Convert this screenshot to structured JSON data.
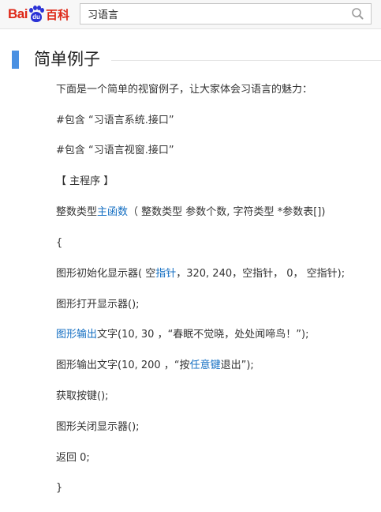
{
  "header": {
    "logo_left": "Bai",
    "logo_paw": "du",
    "logo_right": "百科",
    "search_value": "习语言"
  },
  "section": {
    "title": "简单例子"
  },
  "content": {
    "intro": "下面是一个简单的视窗例子，让大家体会习语言的魅力：",
    "include1": "#包含 “习语言系统.接口”",
    "include2": "#包含 “习语言视窗.接口”",
    "main_program": "【 主程序 】",
    "func_prefix": "整数类型",
    "func_link": "主函数",
    "func_suffix": "（ 整数类型 参数个数, 字符类型 *参数表[])",
    "open_brace": "{",
    "init_prefix": "图形初始化显示器( 空",
    "init_link": "指针",
    "init_suffix": "，320, 240，空指针，  0，  空指针);",
    "open_display": "图形打开显示器();",
    "out1_link": "图形输出",
    "out1_suffix": "文字(10, 30 ，“春眠不觉晓，处处闻啼鸟！”);",
    "out2_prefix": "图形输出文字(10, 200 ，“按",
    "out2_link": "任意键",
    "out2_suffix": "退出”);",
    "get_key": "获取按键();",
    "close_display": "图形关闭显示器();",
    "return_stmt": "返回 0;",
    "close_brace": "}"
  }
}
